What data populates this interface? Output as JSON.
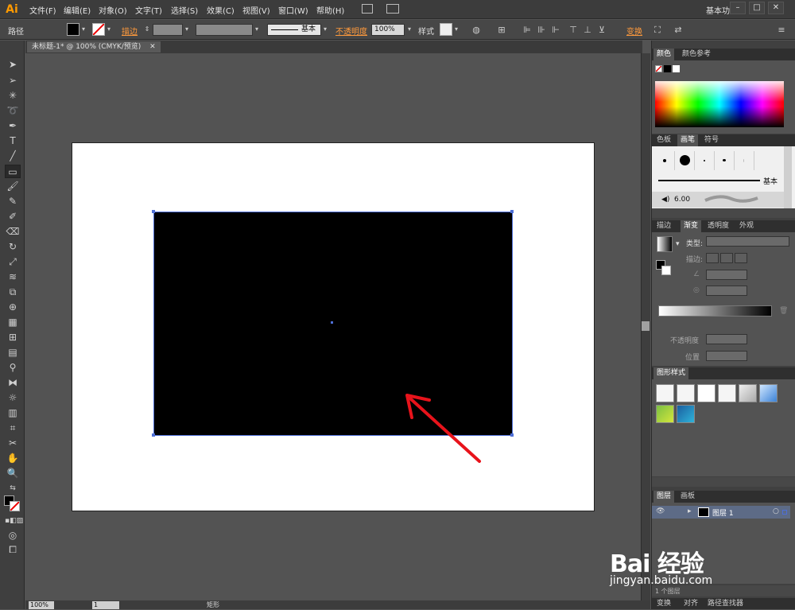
{
  "menubar": {
    "logo": "Ai",
    "menus": [
      "文件(F)",
      "编辑(E)",
      "对象(O)",
      "文字(T)",
      "选择(S)",
      "效果(C)",
      "视图(V)",
      "窗口(W)",
      "帮助(H)"
    ],
    "workspace": "基本功能",
    "window_buttons": [
      "–",
      "□",
      "✕"
    ]
  },
  "controlbar": {
    "selection_type": "路径",
    "stroke_label": "描边",
    "stroke_style": "基本",
    "opacity_label": "不透明度",
    "opacity_value": "100%",
    "style_label": "样式",
    "transform_label": "变换"
  },
  "document": {
    "tab_title": "未标题-1* @ 100% (CMYK/预览)",
    "tab_close": "✕"
  },
  "statusbar": {
    "zoom": "100%",
    "artboard": "1",
    "tool_name": "矩形"
  },
  "panels": {
    "color": {
      "tabs": [
        "颜色",
        "颜色参考"
      ]
    },
    "swatches": {
      "tabs": [
        "色板",
        "画笔",
        "符号"
      ],
      "brush_basic": "基本",
      "brush_size": "6.00"
    },
    "gradient": {
      "tabs": [
        "描边",
        "渐变",
        "透明度",
        "外观"
      ],
      "type_label": "类型:",
      "stroke_label": "描边:",
      "opacity_label": "不透明度",
      "position_label": "位置"
    },
    "graphic_styles": {
      "tabs": [
        "图形样式"
      ]
    },
    "layers": {
      "tabs": [
        "图层",
        "画板"
      ],
      "layer_name": "图层 1",
      "footer": "1 个图层"
    },
    "bottom": {
      "tabs": [
        "变换",
        "对齐",
        "路径查找器"
      ]
    }
  },
  "watermark": {
    "brand": "Bai 经验",
    "url": "jingyan.baidu.com"
  },
  "colors": {
    "accent": "#ff9a3c",
    "selection": "#4e6fd6",
    "arrow": "#e8131b"
  }
}
